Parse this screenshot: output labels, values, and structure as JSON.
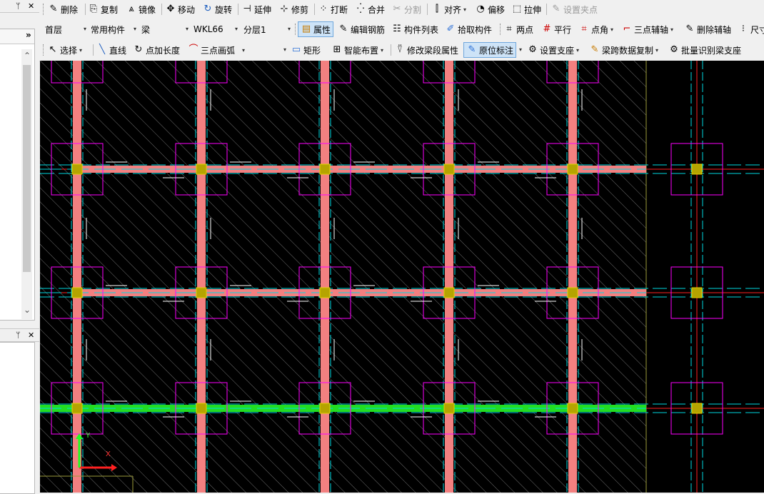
{
  "window": {
    "pin_glyph": "ᛘ",
    "close_glyph": "✕",
    "expand_glyph": "»"
  },
  "toolbar1": {
    "items": [
      {
        "label": "删除",
        "icon": "eraser-icon",
        "disabled": false
      },
      {
        "label": "复制",
        "icon": "copy-icon",
        "disabled": false
      },
      {
        "label": "镜像",
        "icon": "mirror-icon",
        "disabled": false
      },
      {
        "label": "移动",
        "icon": "move-icon",
        "disabled": false
      },
      {
        "label": "旋转",
        "icon": "rotate-icon",
        "disabled": false
      },
      {
        "label": "延伸",
        "icon": "extend-icon",
        "disabled": false
      },
      {
        "label": "修剪",
        "icon": "trim-icon",
        "disabled": false
      },
      {
        "label": "打断",
        "icon": "break-icon",
        "disabled": false
      },
      {
        "label": "合并",
        "icon": "merge-icon",
        "disabled": false
      },
      {
        "label": "分割",
        "icon": "split-icon",
        "disabled": true
      },
      {
        "label": "对齐",
        "icon": "align-icon",
        "disabled": false
      },
      {
        "label": "偏移",
        "icon": "offset-icon",
        "disabled": false
      },
      {
        "label": "拉伸",
        "icon": "stretch-icon",
        "disabled": false
      },
      {
        "label": "设置夹点",
        "icon": "grip-point-icon",
        "disabled": true
      }
    ]
  },
  "toolbar2": {
    "floor": "首层",
    "component_type": "常用构件",
    "component_category": "梁",
    "component_name": "WKL66",
    "layer": "分层1",
    "items": [
      {
        "label": "属性",
        "icon": "properties-icon",
        "active": true
      },
      {
        "label": "编辑钢筋",
        "icon": "edit-rebar-icon",
        "active": false
      },
      {
        "label": "构件列表",
        "icon": "component-list-icon",
        "active": false
      },
      {
        "label": "拾取构件",
        "icon": "pick-component-icon",
        "active": false
      },
      {
        "label": "两点",
        "icon": "two-point-axis-icon",
        "active": false
      },
      {
        "label": "平行",
        "icon": "parallel-axis-icon",
        "active": false
      },
      {
        "label": "点角",
        "icon": "point-angle-icon",
        "active": false
      },
      {
        "label": "三点辅轴",
        "icon": "three-point-axis-icon",
        "active": false
      },
      {
        "label": "删除辅轴",
        "icon": "delete-axis-icon",
        "active": false
      },
      {
        "label": "尺寸",
        "icon": "dimension-icon",
        "active": false
      }
    ]
  },
  "toolbar3": {
    "items": [
      {
        "label": "选择",
        "icon": "select-cursor-icon",
        "active": false
      },
      {
        "label": "直线",
        "icon": "line-icon",
        "active": false
      },
      {
        "label": "点加长度",
        "icon": "point-length-icon",
        "active": false
      },
      {
        "label": "三点画弧",
        "icon": "arc-icon",
        "active": false
      },
      {
        "label": "矩形",
        "icon": "rectangle-icon",
        "active": false
      },
      {
        "label": "智能布置",
        "icon": "smart-layout-icon",
        "active": false
      },
      {
        "label": "修改梁段属性",
        "icon": "modify-beam-segment-icon",
        "active": false
      },
      {
        "label": "原位标注",
        "icon": "in-situ-annotation-icon",
        "active": true
      },
      {
        "label": "设置支座",
        "icon": "set-support-icon",
        "active": false
      },
      {
        "label": "梁跨数据复制",
        "icon": "span-data-copy-icon",
        "active": false
      },
      {
        "label": "批量识别梁支座",
        "icon": "batch-identify-support-icon",
        "active": false
      }
    ]
  },
  "colors": {
    "canvas_bg": "#000000",
    "beam": "#f28080",
    "selected_beam": "#22dd22",
    "column_box": "#ff00ff",
    "column": "#b5a400",
    "axis_line": "#ff2020",
    "cyan_line": "#00d8e0",
    "hatch": "#8a8a8a"
  },
  "canvas": {
    "coord_axis_x_label": "X",
    "coord_axis_y_label": "Y"
  }
}
